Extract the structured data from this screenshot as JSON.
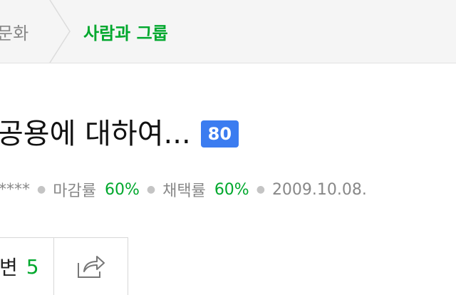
{
  "breadcrumb": {
    "previous": "문화",
    "current": "사람과 그룹"
  },
  "question": {
    "title": "공용에 대하여...",
    "points": "80"
  },
  "meta": {
    "user": "****",
    "closing_rate_label": "마감률",
    "closing_rate_value": "60%",
    "adoption_rate_label": "채택률",
    "adoption_rate_value": "60%",
    "date": "2009.10.08."
  },
  "actions": {
    "answer_label": "변",
    "answer_count": "5"
  },
  "colors": {
    "accent_green": "#00a82d",
    "badge_blue": "#3b7cf0"
  }
}
